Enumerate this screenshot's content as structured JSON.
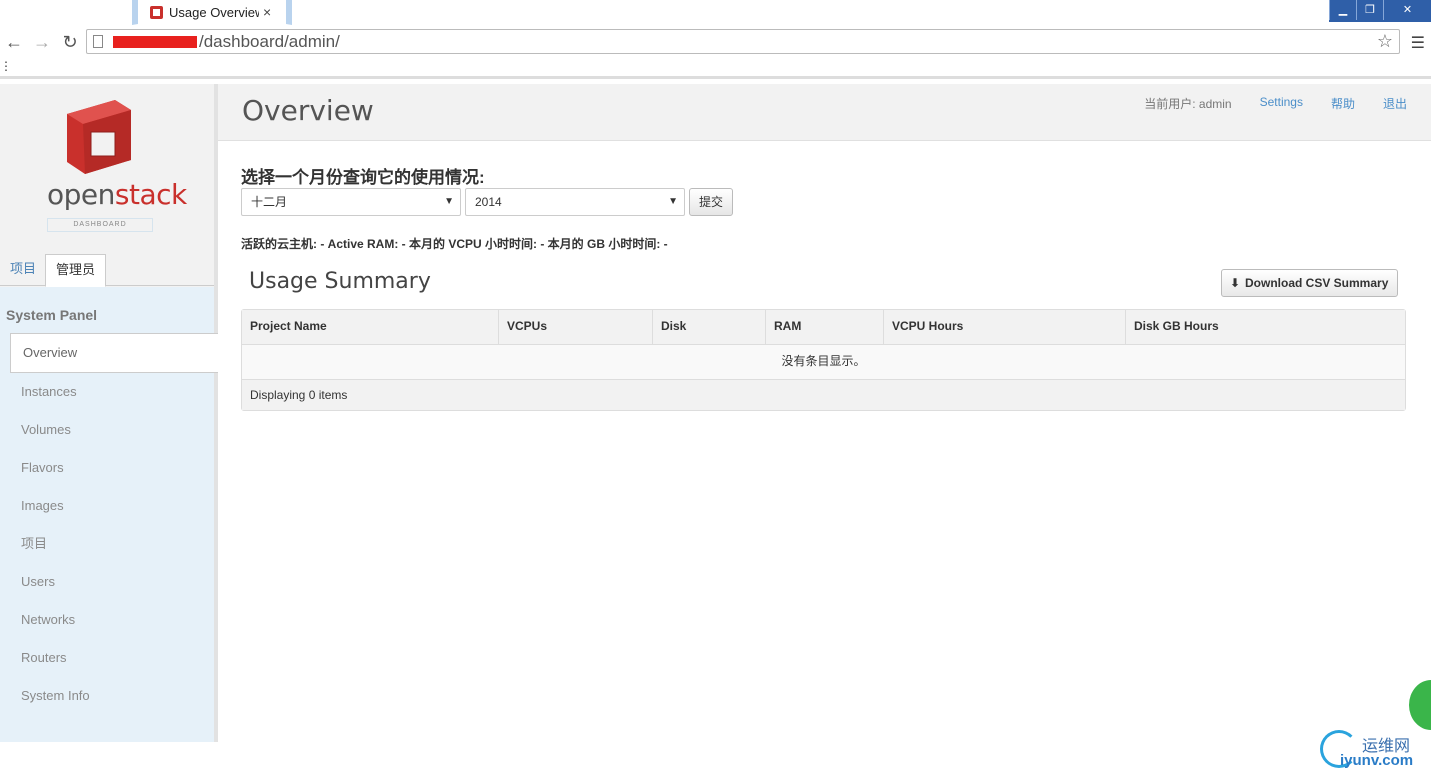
{
  "browser": {
    "tab_title": "Usage Overview",
    "url_path": "/dashboard/admin/",
    "bookmark_dots": "⋮"
  },
  "brand": {
    "logo_open": "open",
    "logo_stack": "stack",
    "logo_sub": "DASHBOARD"
  },
  "sidebar": {
    "tabs": [
      {
        "label": "项目"
      },
      {
        "label": "管理员"
      }
    ],
    "panel_title": "System Panel",
    "items": [
      {
        "label": "Overview"
      },
      {
        "label": "Instances"
      },
      {
        "label": "Volumes"
      },
      {
        "label": "Flavors"
      },
      {
        "label": "Images"
      },
      {
        "label": "项目"
      },
      {
        "label": "Users"
      },
      {
        "label": "Networks"
      },
      {
        "label": "Routers"
      },
      {
        "label": "System Info"
      }
    ]
  },
  "header": {
    "title": "Overview",
    "current_user": "当前用户: admin",
    "settings": "Settings",
    "help": "帮助",
    "logout": "退出"
  },
  "form": {
    "label": "选择一个月份查询它的使用情况:",
    "month_value": "十二月",
    "year_value": "2014",
    "submit_label": "提交"
  },
  "stats": "活跃的云主机: - Active RAM: - 本月的 VCPU 小时时间: - 本月的 GB 小时时间: -",
  "usage": {
    "title": "Usage Summary",
    "csv_label": "Download CSV Summary",
    "columns": [
      "Project Name",
      "VCPUs",
      "Disk",
      "RAM",
      "VCPU Hours",
      "Disk GB Hours"
    ],
    "empty_text": "没有条目显示。",
    "footer": "Displaying 0 items"
  },
  "watermark": {
    "cn": "运维网",
    "en": "iyunv.com"
  },
  "colors": {
    "accent": "#4b8ec9",
    "brand_red": "#c9302c",
    "sidebar_bg": "#e6f1f9"
  }
}
